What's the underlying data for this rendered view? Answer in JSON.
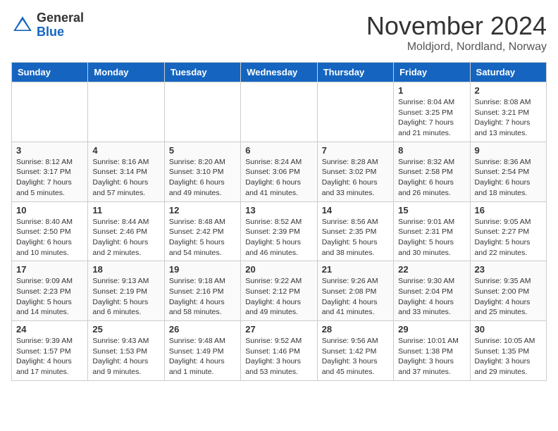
{
  "header": {
    "logo_line1": "General",
    "logo_line2": "Blue",
    "month_title": "November 2024",
    "location": "Moldjord, Nordland, Norway"
  },
  "weekdays": [
    "Sunday",
    "Monday",
    "Tuesday",
    "Wednesday",
    "Thursday",
    "Friday",
    "Saturday"
  ],
  "weeks": [
    [
      {
        "day": "",
        "info": ""
      },
      {
        "day": "",
        "info": ""
      },
      {
        "day": "",
        "info": ""
      },
      {
        "day": "",
        "info": ""
      },
      {
        "day": "",
        "info": ""
      },
      {
        "day": "1",
        "info": "Sunrise: 8:04 AM\nSunset: 3:25 PM\nDaylight: 7 hours\nand 21 minutes."
      },
      {
        "day": "2",
        "info": "Sunrise: 8:08 AM\nSunset: 3:21 PM\nDaylight: 7 hours\nand 13 minutes."
      }
    ],
    [
      {
        "day": "3",
        "info": "Sunrise: 8:12 AM\nSunset: 3:17 PM\nDaylight: 7 hours\nand 5 minutes."
      },
      {
        "day": "4",
        "info": "Sunrise: 8:16 AM\nSunset: 3:14 PM\nDaylight: 6 hours\nand 57 minutes."
      },
      {
        "day": "5",
        "info": "Sunrise: 8:20 AM\nSunset: 3:10 PM\nDaylight: 6 hours\nand 49 minutes."
      },
      {
        "day": "6",
        "info": "Sunrise: 8:24 AM\nSunset: 3:06 PM\nDaylight: 6 hours\nand 41 minutes."
      },
      {
        "day": "7",
        "info": "Sunrise: 8:28 AM\nSunset: 3:02 PM\nDaylight: 6 hours\nand 33 minutes."
      },
      {
        "day": "8",
        "info": "Sunrise: 8:32 AM\nSunset: 2:58 PM\nDaylight: 6 hours\nand 26 minutes."
      },
      {
        "day": "9",
        "info": "Sunrise: 8:36 AM\nSunset: 2:54 PM\nDaylight: 6 hours\nand 18 minutes."
      }
    ],
    [
      {
        "day": "10",
        "info": "Sunrise: 8:40 AM\nSunset: 2:50 PM\nDaylight: 6 hours\nand 10 minutes."
      },
      {
        "day": "11",
        "info": "Sunrise: 8:44 AM\nSunset: 2:46 PM\nDaylight: 6 hours\nand 2 minutes."
      },
      {
        "day": "12",
        "info": "Sunrise: 8:48 AM\nSunset: 2:42 PM\nDaylight: 5 hours\nand 54 minutes."
      },
      {
        "day": "13",
        "info": "Sunrise: 8:52 AM\nSunset: 2:39 PM\nDaylight: 5 hours\nand 46 minutes."
      },
      {
        "day": "14",
        "info": "Sunrise: 8:56 AM\nSunset: 2:35 PM\nDaylight: 5 hours\nand 38 minutes."
      },
      {
        "day": "15",
        "info": "Sunrise: 9:01 AM\nSunset: 2:31 PM\nDaylight: 5 hours\nand 30 minutes."
      },
      {
        "day": "16",
        "info": "Sunrise: 9:05 AM\nSunset: 2:27 PM\nDaylight: 5 hours\nand 22 minutes."
      }
    ],
    [
      {
        "day": "17",
        "info": "Sunrise: 9:09 AM\nSunset: 2:23 PM\nDaylight: 5 hours\nand 14 minutes."
      },
      {
        "day": "18",
        "info": "Sunrise: 9:13 AM\nSunset: 2:19 PM\nDaylight: 5 hours\nand 6 minutes."
      },
      {
        "day": "19",
        "info": "Sunrise: 9:18 AM\nSunset: 2:16 PM\nDaylight: 4 hours\nand 58 minutes."
      },
      {
        "day": "20",
        "info": "Sunrise: 9:22 AM\nSunset: 2:12 PM\nDaylight: 4 hours\nand 49 minutes."
      },
      {
        "day": "21",
        "info": "Sunrise: 9:26 AM\nSunset: 2:08 PM\nDaylight: 4 hours\nand 41 minutes."
      },
      {
        "day": "22",
        "info": "Sunrise: 9:30 AM\nSunset: 2:04 PM\nDaylight: 4 hours\nand 33 minutes."
      },
      {
        "day": "23",
        "info": "Sunrise: 9:35 AM\nSunset: 2:00 PM\nDaylight: 4 hours\nand 25 minutes."
      }
    ],
    [
      {
        "day": "24",
        "info": "Sunrise: 9:39 AM\nSunset: 1:57 PM\nDaylight: 4 hours\nand 17 minutes."
      },
      {
        "day": "25",
        "info": "Sunrise: 9:43 AM\nSunset: 1:53 PM\nDaylight: 4 hours\nand 9 minutes."
      },
      {
        "day": "26",
        "info": "Sunrise: 9:48 AM\nSunset: 1:49 PM\nDaylight: 4 hours\nand 1 minute."
      },
      {
        "day": "27",
        "info": "Sunrise: 9:52 AM\nSunset: 1:46 PM\nDaylight: 3 hours\nand 53 minutes."
      },
      {
        "day": "28",
        "info": "Sunrise: 9:56 AM\nSunset: 1:42 PM\nDaylight: 3 hours\nand 45 minutes."
      },
      {
        "day": "29",
        "info": "Sunrise: 10:01 AM\nSunset: 1:38 PM\nDaylight: 3 hours\nand 37 minutes."
      },
      {
        "day": "30",
        "info": "Sunrise: 10:05 AM\nSunset: 1:35 PM\nDaylight: 3 hours\nand 29 minutes."
      }
    ]
  ]
}
